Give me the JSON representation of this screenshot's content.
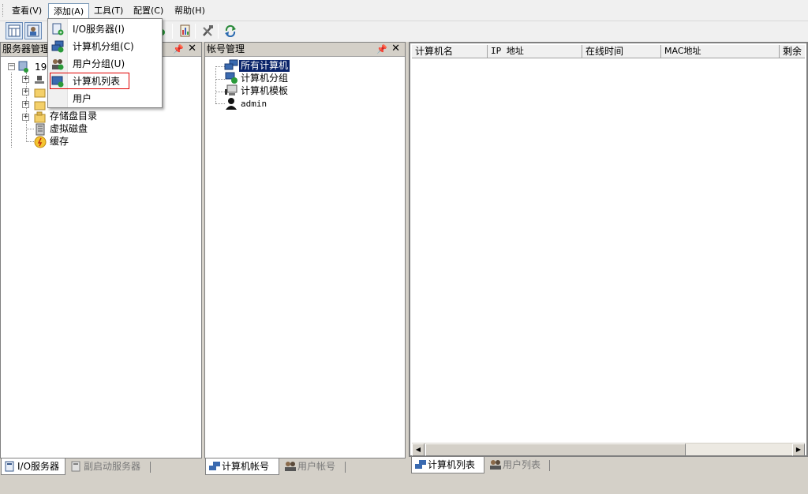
{
  "menubar": {
    "items": [
      {
        "label": "查看(V)"
      },
      {
        "label": "添加(A)"
      },
      {
        "label": "工具(T)"
      },
      {
        "label": "配置(C)"
      },
      {
        "label": "帮助(H)"
      }
    ]
  },
  "add_menu": {
    "items": [
      {
        "label": "I/O服务器(I)",
        "icon": "io-server-add-icon"
      },
      {
        "label": "计算机分组(C)",
        "icon": "computer-group-add-icon"
      },
      {
        "label": "用户分组(U)",
        "icon": "user-group-add-icon"
      },
      {
        "label": "计算机列表",
        "icon": "computer-list-add-icon"
      },
      {
        "label": "用户",
        "icon": ""
      }
    ]
  },
  "server_panel": {
    "title": "服务器管理",
    "root_label": "192",
    "items": [
      {
        "label": "存储盘目录",
        "icon": "storage-folder-icon"
      },
      {
        "label": "虚拟磁盘",
        "icon": "virtual-disk-icon"
      },
      {
        "label": "缓存",
        "icon": "cache-icon"
      }
    ],
    "tabs": [
      {
        "label": "I/O服务器",
        "active": true
      },
      {
        "label": "副启动服务器",
        "active": false
      }
    ]
  },
  "account_panel": {
    "title": "帐号管理",
    "items": [
      {
        "label": "所有计算机",
        "selected": true
      },
      {
        "label": "计算机分组",
        "selected": false
      },
      {
        "label": "计算机模板",
        "selected": false
      },
      {
        "label": "admin",
        "selected": false
      }
    ],
    "tabs": [
      {
        "label": "计算机帐号",
        "active": true
      },
      {
        "label": "用户帐号",
        "active": false
      }
    ]
  },
  "list_panel": {
    "columns": [
      "计算机名",
      "IP 地址",
      "在线时间",
      "MAC地址",
      "剩余"
    ],
    "tabs": [
      {
        "label": "计算机列表",
        "active": true
      },
      {
        "label": "用户列表",
        "active": false
      }
    ]
  },
  "colors": {
    "selection": "#0a246a",
    "highlight_border": "#e00000"
  }
}
